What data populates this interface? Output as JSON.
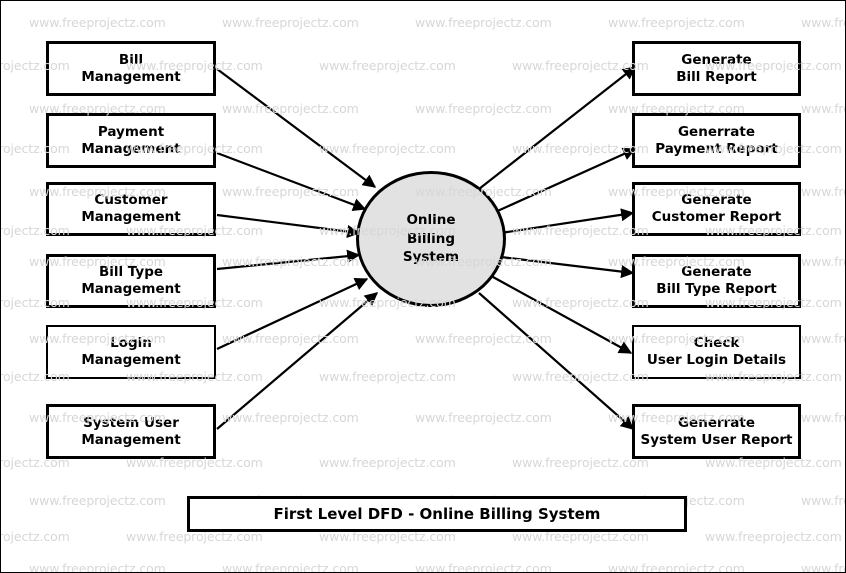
{
  "diagram": {
    "title": "First Level DFD - Online Billing System",
    "process": {
      "name": "Online Billing System",
      "lines": [
        "Online",
        "Billing",
        "System"
      ],
      "fill": "#e2e2e2",
      "stroke": "#000000"
    },
    "inputs": [
      {
        "id": "bill-management",
        "lines": [
          "Bill",
          "Management"
        ]
      },
      {
        "id": "payment-management",
        "lines": [
          "Payment",
          "Management"
        ]
      },
      {
        "id": "customer-management",
        "lines": [
          "Customer",
          "Management"
        ]
      },
      {
        "id": "bill-type-management",
        "lines": [
          "Bill Type",
          "Management"
        ]
      },
      {
        "id": "login-management",
        "lines": [
          "Login",
          "Management"
        ]
      },
      {
        "id": "system-user-management",
        "lines": [
          "System User",
          "Management"
        ]
      }
    ],
    "outputs": [
      {
        "id": "generate-bill-report",
        "lines": [
          "Generate",
          "Bill Report"
        ]
      },
      {
        "id": "generate-payment-report",
        "lines": [
          "Generrate",
          "Payment Report"
        ]
      },
      {
        "id": "generate-customer-report",
        "lines": [
          "Generate",
          "Customer Report"
        ]
      },
      {
        "id": "generate-bill-type-report",
        "lines": [
          "Generate",
          "Bill Type Report"
        ]
      },
      {
        "id": "check-user-login-details",
        "lines": [
          "Check",
          "User Login Details"
        ]
      },
      {
        "id": "generate-system-user-report",
        "lines": [
          "Generrate",
          "System User Report"
        ]
      }
    ],
    "watermark": {
      "text": "www.freeprojectz.com",
      "color": "#d7d7d7"
    }
  }
}
